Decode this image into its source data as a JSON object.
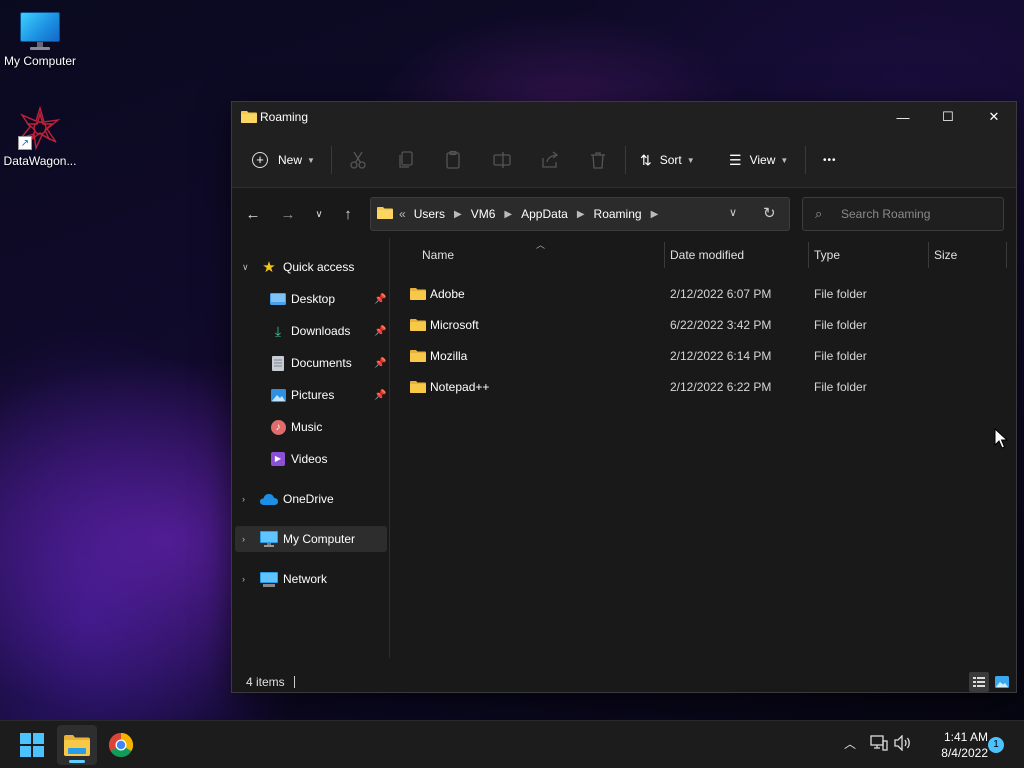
{
  "desktop": {
    "icons": [
      {
        "label": "My Computer",
        "icon": "computer-icon"
      },
      {
        "label": "DataWagon...",
        "icon": "datawagon-shortcut-icon"
      }
    ]
  },
  "window": {
    "title": "Roaming",
    "controls": {
      "minimize": "—",
      "maximize": "☐",
      "close": "✕"
    },
    "commandbar": {
      "new_label": "New",
      "sort_label": "Sort",
      "view_label": "View",
      "more_label": "•••",
      "disabled_actions": [
        "cut-icon",
        "copy-icon",
        "paste-icon",
        "rename-icon",
        "share-icon",
        "delete-icon"
      ]
    },
    "address": {
      "overflow": "«",
      "crumbs": [
        "Users",
        "VM6",
        "AppData",
        "Roaming"
      ],
      "search_placeholder": "Search Roaming"
    },
    "nav": {
      "quick_access": "Quick access",
      "items": [
        {
          "label": "Desktop",
          "pinned": true
        },
        {
          "label": "Downloads",
          "pinned": true
        },
        {
          "label": "Documents",
          "pinned": true
        },
        {
          "label": "Pictures",
          "pinned": true
        },
        {
          "label": "Music",
          "pinned": false
        },
        {
          "label": "Videos",
          "pinned": false
        }
      ],
      "onedrive": "OneDrive",
      "my_computer": "My Computer",
      "network": "Network"
    },
    "list": {
      "headers": {
        "name": "Name",
        "date": "Date modified",
        "type": "Type",
        "size": "Size"
      },
      "rows": [
        {
          "name": "Adobe",
          "date": "2/12/2022 6:07 PM",
          "type": "File folder"
        },
        {
          "name": "Microsoft",
          "date": "6/22/2022 3:42 PM",
          "type": "File folder"
        },
        {
          "name": "Mozilla",
          "date": "2/12/2022 6:14 PM",
          "type": "File folder"
        },
        {
          "name": "Notepad++",
          "date": "2/12/2022 6:22 PM",
          "type": "File folder"
        }
      ]
    },
    "status": {
      "count": "4 items"
    }
  },
  "taskbar": {
    "time": "1:41 AM",
    "date": "8/4/2022",
    "notifications": "1"
  },
  "colors": {
    "accent": "#60cdff",
    "folder": "#f8c948",
    "window_bg": "#191919"
  }
}
